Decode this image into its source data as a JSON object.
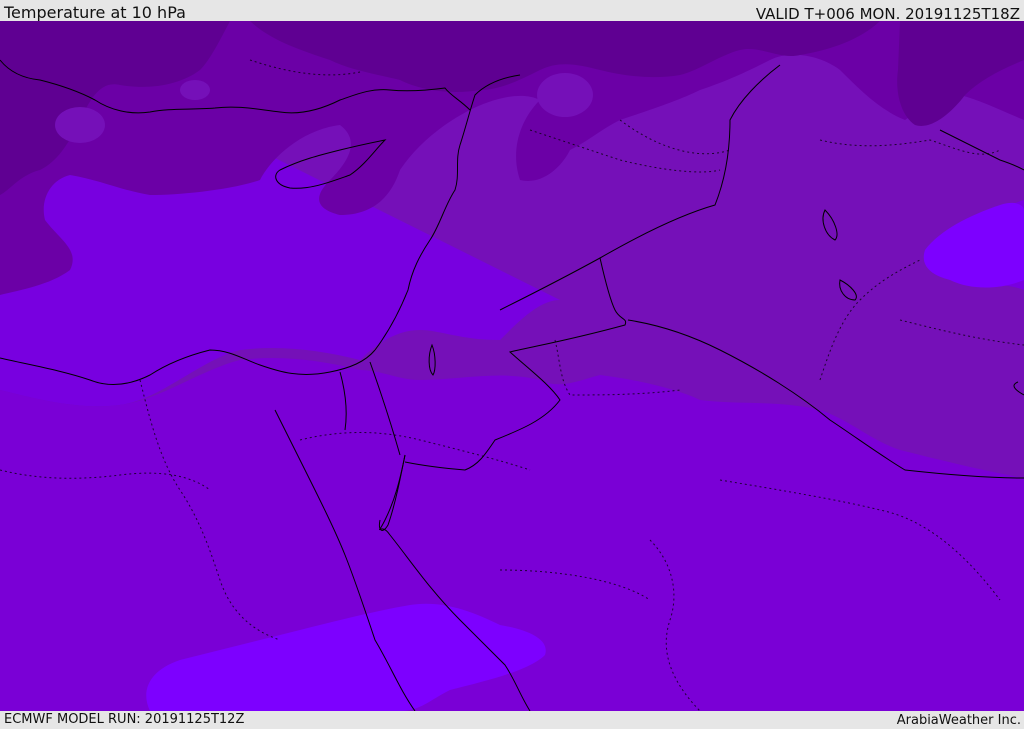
{
  "header": {
    "title": "Temperature at 10 hPa",
    "valid_time": "VALID T+006 MON. 20191125T18Z"
  },
  "footer": {
    "model_run": "ECMWF MODEL RUN: 20191125T12Z",
    "credit": "ArabiaWeather Inc."
  },
  "map": {
    "field": "temperature",
    "level": "10 hPa",
    "colors": {
      "darkest": "#5f0092",
      "dark": "#6b00a6",
      "mid": "#7510b8",
      "light": "#7a00d6",
      "lightest": "#7d00ff",
      "coastline": "#000000",
      "border": "#000000"
    }
  }
}
